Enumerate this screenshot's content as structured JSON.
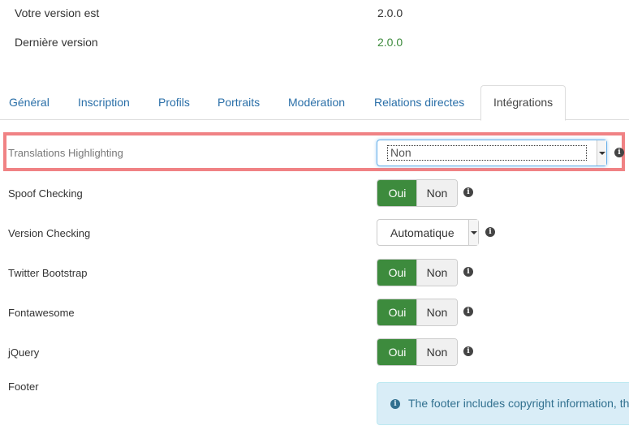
{
  "version_info": {
    "current_label": "Votre version est",
    "current_value": "2.0.0",
    "latest_label": "Dernière version",
    "latest_value": "2.0.0"
  },
  "tabs": [
    {
      "label": "Général"
    },
    {
      "label": "Inscription"
    },
    {
      "label": "Profils"
    },
    {
      "label": "Portraits"
    },
    {
      "label": "Modération"
    },
    {
      "label": "Relations directes"
    },
    {
      "label": "Intégrations",
      "active": true
    }
  ],
  "settings": {
    "translations_highlighting": {
      "label": "Translations Highlighting",
      "value": "Non"
    },
    "spoof_checking": {
      "label": "Spoof Checking",
      "yes": "Oui",
      "no": "Non",
      "selected": "Oui"
    },
    "version_checking": {
      "label": "Version Checking",
      "value": "Automatique"
    },
    "twitter_bootstrap": {
      "label": "Twitter Bootstrap",
      "yes": "Oui",
      "no": "Non",
      "selected": "Oui"
    },
    "fontawesome": {
      "label": "Fontawesome",
      "yes": "Oui",
      "no": "Non",
      "selected": "Oui"
    },
    "jquery": {
      "label": "jQuery",
      "yes": "Oui",
      "no": "Non",
      "selected": "Oui"
    },
    "footer": {
      "label": "Footer",
      "info_text": "The footer includes copyright information, th"
    }
  },
  "colors": {
    "accent_green": "#3d8b3d",
    "link_blue": "#2a6fa8",
    "highlight_red": "#f08284",
    "info_bg": "#d9edf7",
    "info_text": "#31708f"
  }
}
